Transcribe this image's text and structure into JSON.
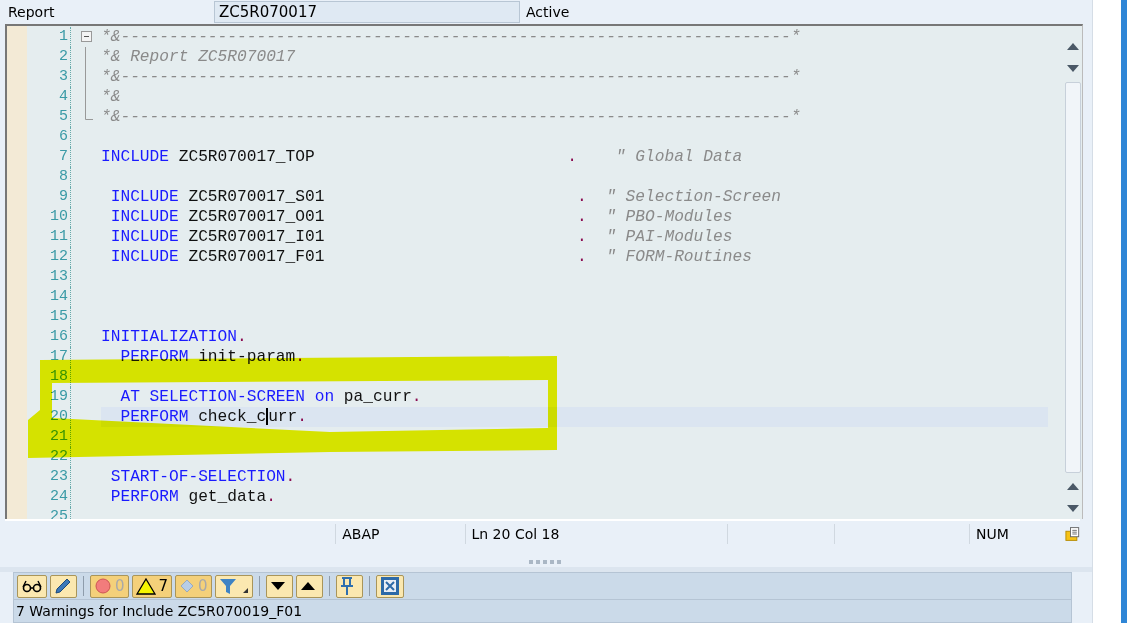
{
  "header": {
    "label": "Report",
    "name": "ZC5R070017",
    "status": "Active"
  },
  "editor": {
    "lines": [
      {
        "number": "1",
        "kind": "foldstart",
        "tokens": [
          {
            "kind": "comment",
            "text": "*&---------------------------------------------------------------------*"
          }
        ]
      },
      {
        "number": "2",
        "kind": "foldmid",
        "tokens": [
          {
            "kind": "comment",
            "text": "*& Report ZC5R070017"
          }
        ]
      },
      {
        "number": "3",
        "kind": "foldmid",
        "tokens": [
          {
            "kind": "comment",
            "text": "*&---------------------------------------------------------------------*"
          }
        ]
      },
      {
        "number": "4",
        "kind": "foldmid",
        "tokens": [
          {
            "kind": "comment",
            "text": "*&"
          }
        ]
      },
      {
        "number": "5",
        "kind": "foldend",
        "tokens": [
          {
            "kind": "comment",
            "text": "*&---------------------------------------------------------------------*"
          }
        ]
      },
      {
        "number": "6"
      },
      {
        "number": "7",
        "tokens": [
          {
            "kind": "keyword",
            "text": "INCLUDE"
          },
          {
            "kind": "ident",
            "text": " ZC5R070017_TOP"
          },
          {
            "kind": "period",
            "text": "                          ."
          },
          {
            "kind": "comment",
            "text": "    \" Global Data"
          }
        ]
      },
      {
        "number": "8"
      },
      {
        "number": "9",
        "tokens": [
          {
            "kind": "keyword",
            "text": " INCLUDE"
          },
          {
            "kind": "ident",
            "text": " ZC5R070017_S01"
          },
          {
            "kind": "period",
            "text": "                          ."
          },
          {
            "kind": "comment",
            "text": "  \" Selection-Screen"
          }
        ]
      },
      {
        "number": "10",
        "tokens": [
          {
            "kind": "keyword",
            "text": " INCLUDE"
          },
          {
            "kind": "ident",
            "text": " ZC5R070017_O01"
          },
          {
            "kind": "period",
            "text": "                          ."
          },
          {
            "kind": "comment",
            "text": "  \" PBO-Modules"
          }
        ]
      },
      {
        "number": "11",
        "tokens": [
          {
            "kind": "keyword",
            "text": " INCLUDE"
          },
          {
            "kind": "ident",
            "text": " ZC5R070017_I01"
          },
          {
            "kind": "period",
            "text": "                          ."
          },
          {
            "kind": "comment",
            "text": "  \" PAI-Modules"
          }
        ]
      },
      {
        "number": "12",
        "tokens": [
          {
            "kind": "keyword",
            "text": " INCLUDE"
          },
          {
            "kind": "ident",
            "text": " ZC5R070017_F01"
          },
          {
            "kind": "period",
            "text": "                          ."
          },
          {
            "kind": "comment",
            "text": "  \" FORM-Routines"
          }
        ]
      },
      {
        "number": "13"
      },
      {
        "number": "14"
      },
      {
        "number": "15"
      },
      {
        "number": "16",
        "tokens": [
          {
            "kind": "keyword",
            "text": "INITIALIZATION"
          },
          {
            "kind": "period",
            "text": "."
          }
        ]
      },
      {
        "number": "17",
        "tokens": [
          {
            "kind": "keyword",
            "text": "  PERFORM"
          },
          {
            "kind": "ident",
            "text": " init-param"
          },
          {
            "kind": "period",
            "text": "."
          }
        ]
      },
      {
        "number": "18"
      },
      {
        "number": "19",
        "tokens": [
          {
            "kind": "keyword",
            "text": "  AT SELECTION-SCREEN on"
          },
          {
            "kind": "ident",
            "text": " pa_curr"
          },
          {
            "kind": "period",
            "text": "."
          }
        ]
      },
      {
        "number": "20",
        "current": true,
        "tokens": [
          {
            "kind": "keyword",
            "text": "  PERFORM"
          },
          {
            "kind": "ident",
            "text": " check_c"
          },
          {
            "kind": "cursor"
          },
          {
            "kind": "ident",
            "text": "urr"
          },
          {
            "kind": "period",
            "text": "."
          }
        ]
      },
      {
        "number": "21"
      },
      {
        "number": "22"
      },
      {
        "number": "23",
        "tokens": [
          {
            "kind": "keyword",
            "text": " START-OF-SELECTION"
          },
          {
            "kind": "period",
            "text": "."
          }
        ]
      },
      {
        "number": "24",
        "tokens": [
          {
            "kind": "keyword",
            "text": " PERFORM"
          },
          {
            "kind": "ident",
            "text": " get_data"
          },
          {
            "kind": "period",
            "text": "."
          }
        ]
      },
      {
        "number": "25"
      }
    ]
  },
  "status_bar": {
    "language": "ABAP",
    "position": "Ln  20 Col  18",
    "mode": "NUM"
  },
  "messages": {
    "toolbar": [
      {
        "kind": "glasses"
      },
      {
        "kind": "pencil"
      },
      {
        "kind": "separator"
      },
      {
        "kind": "error",
        "count": "0",
        "disabled": true
      },
      {
        "kind": "warning",
        "count": "7",
        "disabled": false
      },
      {
        "kind": "info",
        "count": "0",
        "disabled": true
      },
      {
        "kind": "filter"
      },
      {
        "kind": "separator"
      },
      {
        "kind": "down"
      },
      {
        "kind": "up"
      },
      {
        "kind": "separator"
      },
      {
        "kind": "pin"
      },
      {
        "kind": "separator"
      },
      {
        "kind": "close"
      }
    ],
    "text": "7 Warnings for Include ZC5R070019_F01"
  }
}
